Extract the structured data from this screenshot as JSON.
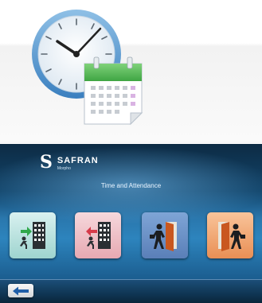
{
  "header": {
    "icon": "clock-calendar-icon"
  },
  "device": {
    "logo": {
      "brand": "SAFRAN",
      "sub_brand": "Morpho"
    },
    "screen_title": "Time and Attendance",
    "tiles": [
      {
        "icon": "person-enter-building-icon"
      },
      {
        "icon": "person-exit-building-icon"
      },
      {
        "icon": "person-enter-door-icon"
      },
      {
        "icon": "person-exit-door-icon"
      }
    ],
    "footer": {
      "back_icon": "arrow-left-icon"
    }
  },
  "colors": {
    "screen_blue": "#2d84bd",
    "tile_teal": "#bfe4e1",
    "tile_pink": "#eebcc3",
    "tile_blue": "#6c92c7",
    "tile_orange": "#f2a873",
    "arrow_blue": "#1f5ea8"
  }
}
